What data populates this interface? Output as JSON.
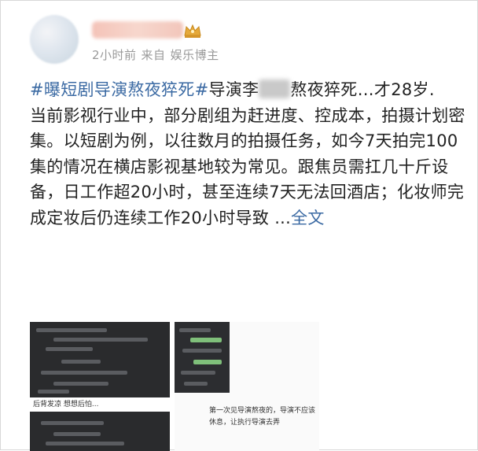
{
  "post": {
    "author_name": "",
    "time": "2小时前",
    "source_prefix": "来自",
    "source": "娱乐博主",
    "hashtag": "#曝短剧导演熬夜猝死#",
    "headline_before": "导演李",
    "headline_after": "熬夜猝死…才28岁.",
    "body": "当前影视行业中，部分剧组为赶进度、控成本，拍摄计划密集。以短剧为例，以往数月的拍摄任务，如今7天拍完100集的情况在横店影视基地较为常见。跟焦员需扛几十斤设备，日工作超20小时，甚至连续7天无法回酒店；化妆师完成定妆后仍连续工作20小时导致 ...",
    "full_text_link": "全文"
  },
  "images": {
    "img1_strip": "后背发凉 想想后怕...",
    "img2_note": "第一次见导演熬夜的，导演不应该休息，让执行导演去弄"
  },
  "colors": {
    "link": "#3b6aa3",
    "meta": "#9a9a9a",
    "text": "#222222"
  }
}
